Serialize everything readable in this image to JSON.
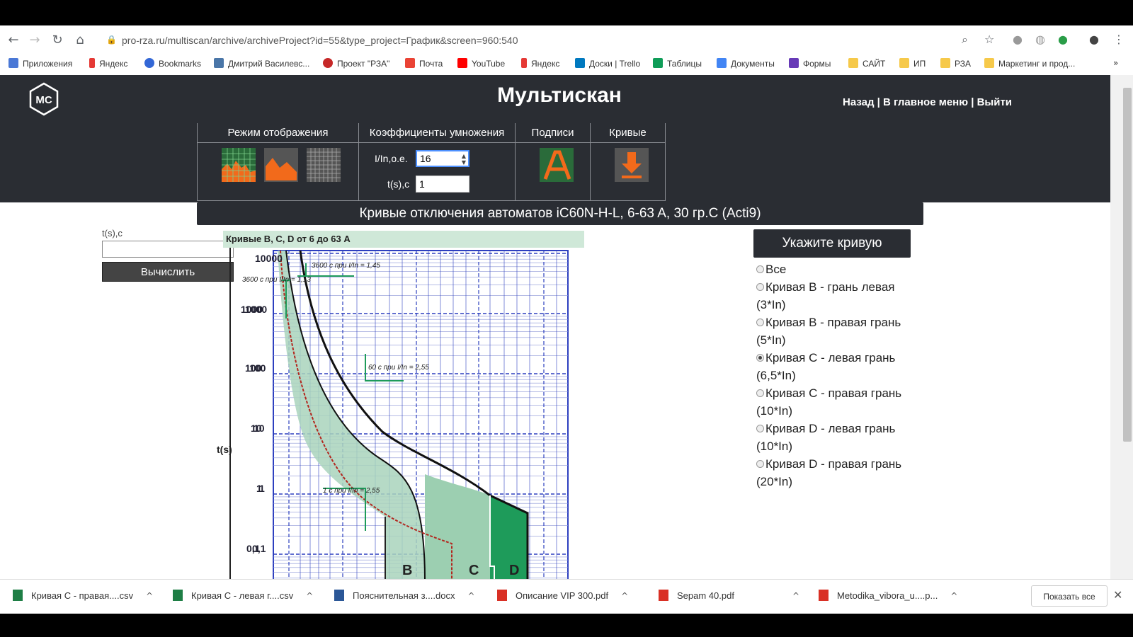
{
  "browser": {
    "url": "pro-rza.ru/multiscan/archive/archiveProject?id=55&type_project=График&screen=960:540",
    "bookmarks": [
      "Приложения",
      "Яндекс",
      "Bookmarks",
      "Дмитрий Василевс...",
      "Проект \"РЗА\"",
      "Почта",
      "YouTube",
      "Яндекс",
      "Доски | Trello",
      "Таблицы",
      "Документы",
      "Формы",
      "САЙТ",
      "ИП",
      "РЗА",
      "Маркетинг и прод..."
    ]
  },
  "header": {
    "logo_text": "MC",
    "title": "Мультискан",
    "link_back": "Назад",
    "link_main": "В главное меню",
    "link_exit": "Выйти",
    "separator": "|"
  },
  "toolbar": {
    "group_display": "Режим отображения",
    "group_coef": "Коэффициенты умножения",
    "group_labels": "Подписи",
    "group_curves": "Кривые",
    "coef_i_label": "I/In,o.e.",
    "coef_i_value": "16",
    "coef_t_label": "t(s),c",
    "coef_t_value": "1"
  },
  "chart_title": "Кривые отключения автоматов iC60N-H-L, 6-63 A, 30 гр.C (Acti9)",
  "calc": {
    "label": "t(s),c",
    "value": "",
    "button": "Вычислить"
  },
  "chart_data": {
    "type": "line",
    "title": "Кривые B, C, D от 6 до 63 A",
    "ylabel": "t(s)",
    "yscale": "log",
    "y_ticks": [
      "10000",
      "1000",
      "100",
      "10",
      "1",
      "0.1"
    ],
    "y_tick_text_double": [
      "10000",
      "1000",
      "1000",
      "100",
      "100",
      "10",
      "10",
      "1",
      "1",
      "0,1",
      "0,1"
    ],
    "annotations": [
      "3600 с при I/In = 1,45",
      "3600 с при I/In = 1,13",
      "60 с при I/In = 2,55",
      "1 с при I/In = 2,55"
    ],
    "curve_labels": [
      "B",
      "C",
      "D"
    ],
    "colors": {
      "band": "#a9d4bc",
      "band_dark": "#1e9b5a",
      "grid": "#2d3fbf",
      "upper": "#111111",
      "lower": "#b3261e"
    }
  },
  "curve_selector": {
    "header": "Укажите кривую",
    "options": [
      {
        "label": "Все",
        "checked": false
      },
      {
        "label": "Кривая B - грань левая (3*In)",
        "checked": false
      },
      {
        "label": "Кривая B - правая грань (5*In)",
        "checked": false
      },
      {
        "label": "Кривая C - левая грань (6,5*In)",
        "checked": true
      },
      {
        "label": "Кривая C - правая грань (10*In)",
        "checked": false
      },
      {
        "label": "Кривая D - левая грань (10*In)",
        "checked": false
      },
      {
        "label": "Кривая D - правая грань (20*In)",
        "checked": false
      }
    ]
  },
  "downloads": {
    "items": [
      "Кривая С - правая....csv",
      "Кривая С - левая г....csv",
      "Пояснительная з....docx",
      "Описание VIP 300.pdf",
      "Sepam 40.pdf",
      "Metodika_vibora_u....p..."
    ],
    "show_all": "Показать все"
  }
}
